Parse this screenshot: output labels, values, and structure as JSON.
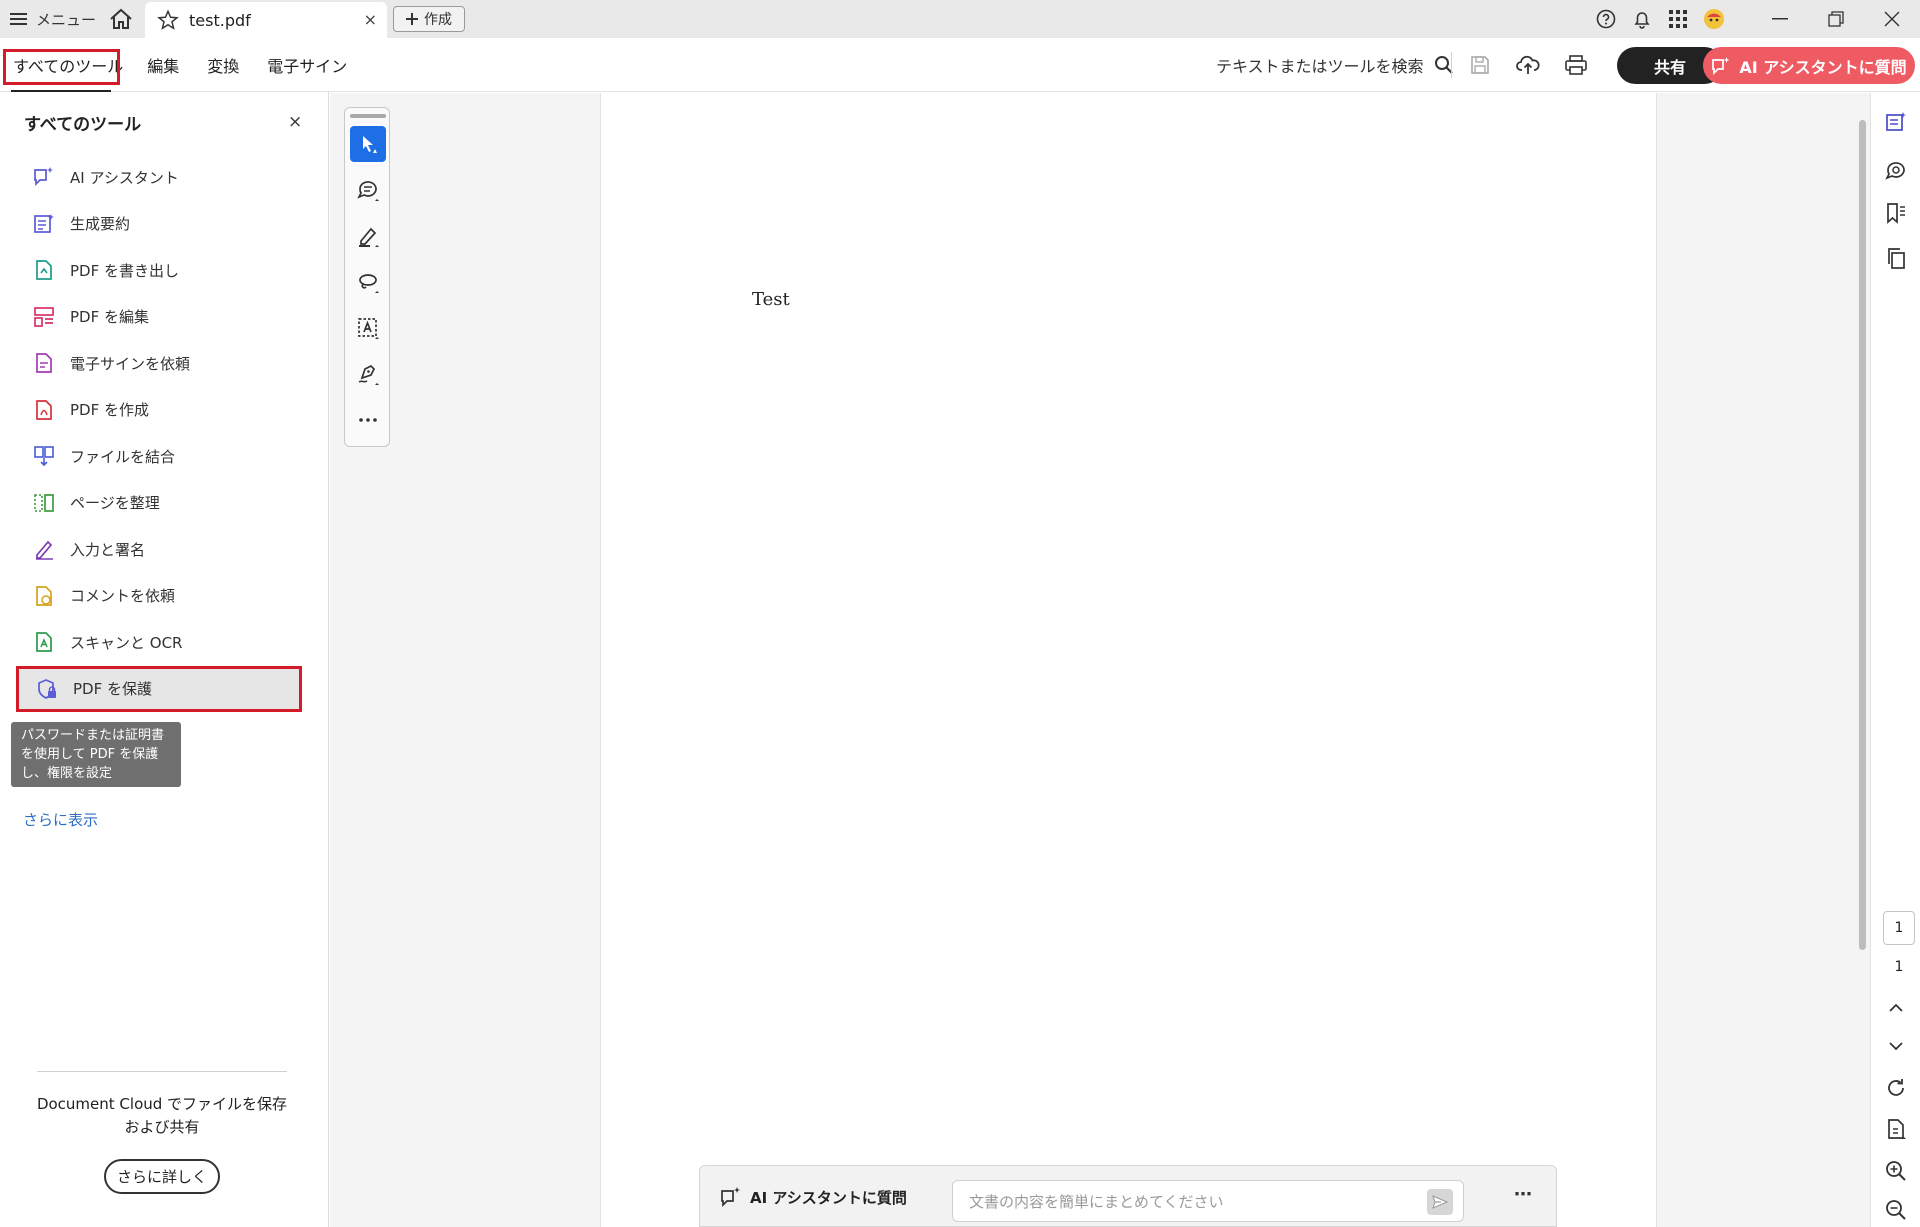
{
  "titlebar": {
    "menu_label": "メニュー",
    "tab_title": "test.pdf",
    "tab_close": "×",
    "new_label": "作成"
  },
  "toolbar": {
    "tabs": [
      "すべてのツール",
      "編集",
      "変換",
      "電子サイン"
    ],
    "search_label": "テキストまたはツールを検索",
    "share_label": "共有",
    "ai_label": "AI アシスタントに質問"
  },
  "leftpanel": {
    "title": "すべてのツール",
    "close": "×",
    "tools": [
      {
        "label": "AI アシスタント",
        "icon": "ai-assistant-icon",
        "color": "#5b5bd6"
      },
      {
        "label": "生成要約",
        "icon": "summary-icon",
        "color": "#5b5bd6"
      },
      {
        "label": "PDF を書き出し",
        "icon": "export-pdf-icon",
        "color": "#1c9c8c"
      },
      {
        "label": "PDF を編集",
        "icon": "edit-pdf-icon",
        "color": "#d6336c"
      },
      {
        "label": "電子サインを依頼",
        "icon": "request-esign-icon",
        "color": "#a23cb4"
      },
      {
        "label": "PDF を作成",
        "icon": "create-pdf-icon",
        "color": "#d6333a"
      },
      {
        "label": "ファイルを結合",
        "icon": "combine-files-icon",
        "color": "#4b5bd6"
      },
      {
        "label": "ページを整理",
        "icon": "organize-pages-icon",
        "color": "#3c9c3c"
      },
      {
        "label": "入力と署名",
        "icon": "fill-sign-icon",
        "color": "#7b3cb4"
      },
      {
        "label": "コメントを依頼",
        "icon": "request-comment-icon",
        "color": "#d6a21b"
      },
      {
        "label": "スキャンと OCR",
        "icon": "scan-ocr-icon",
        "color": "#2c9c4c"
      },
      {
        "label": "PDF を保護",
        "icon": "protect-pdf-icon",
        "color": "#5b5bd6"
      }
    ],
    "tooltip": "パスワードまたは証明書を使用して PDF を保護し、権限を設定",
    "more_link": "さらに表示",
    "cloud_text": "Document Cloud でファイルを保存および共有",
    "learn_more": "さらに詳しく"
  },
  "document": {
    "text": "Test"
  },
  "pager": {
    "current": "1",
    "total": "1"
  },
  "aibar": {
    "label": "AI アシスタントに質問",
    "placeholder": "文書の内容を簡単にまとめてください",
    "more": "⋯"
  },
  "colors": {
    "highlight_red": "#d31b29",
    "ai_button": "#ef5b63",
    "selection_blue": "#1e6ee6",
    "link_blue": "#2c6dc6"
  }
}
